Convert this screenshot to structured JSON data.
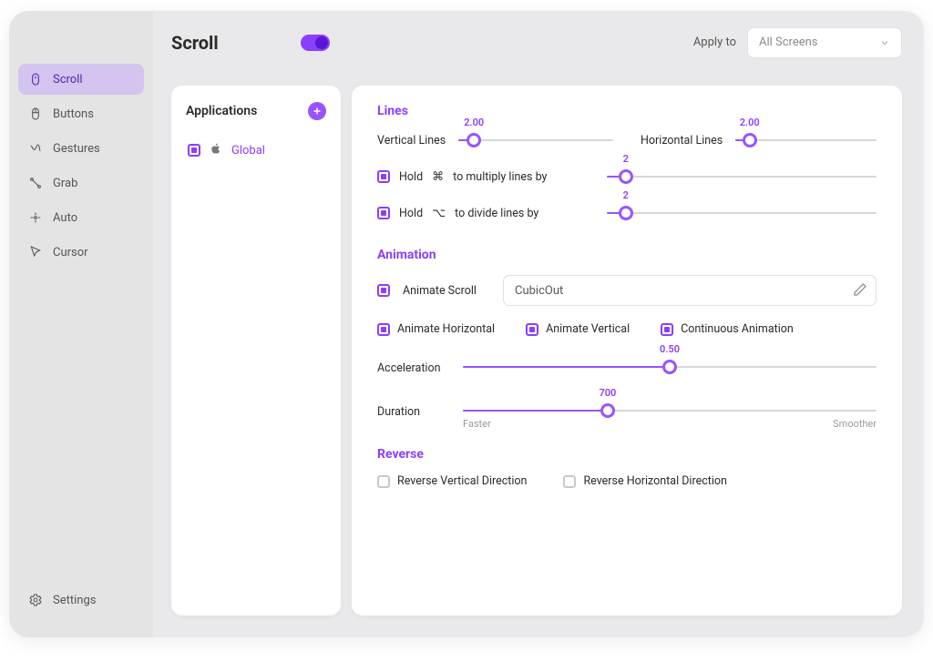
{
  "sidebar": {
    "items": [
      {
        "label": "Scroll",
        "icon": "mouse"
      },
      {
        "label": "Buttons",
        "icon": "mouse-button"
      },
      {
        "label": "Gestures",
        "icon": "gesture"
      },
      {
        "label": "Grab",
        "icon": "grab"
      },
      {
        "label": "Auto",
        "icon": "auto"
      },
      {
        "label": "Cursor",
        "icon": "cursor"
      }
    ],
    "settings_label": "Settings"
  },
  "header": {
    "title": "Scroll",
    "enabled": true,
    "apply_to_label": "Apply to",
    "apply_to_value": "All Screens"
  },
  "apps": {
    "title": "Applications",
    "items": [
      {
        "label": "Global"
      }
    ]
  },
  "lines": {
    "title": "Lines",
    "vertical_label": "Vertical Lines",
    "vertical_value": "2.00",
    "horizontal_label": "Horizontal Lines",
    "horizontal_value": "2.00",
    "hold_word": "Hold",
    "multiply_text": "to multiply lines by",
    "multiply_value": "2",
    "divide_text": "to divide lines by",
    "divide_value": "2"
  },
  "animation": {
    "title": "Animation",
    "animate_scroll_label": "Animate Scroll",
    "easing_value": "CubicOut",
    "animate_horizontal": "Animate Horizontal",
    "animate_vertical": "Animate Vertical",
    "continuous": "Continuous Animation",
    "acceleration_label": "Acceleration",
    "acceleration_value": "0.50",
    "duration_label": "Duration",
    "duration_value": "700",
    "faster": "Faster",
    "smoother": "Smoother"
  },
  "reverse": {
    "title": "Reverse",
    "vertical": "Reverse Vertical Direction",
    "horizontal": "Reverse Horizontal Direction"
  }
}
